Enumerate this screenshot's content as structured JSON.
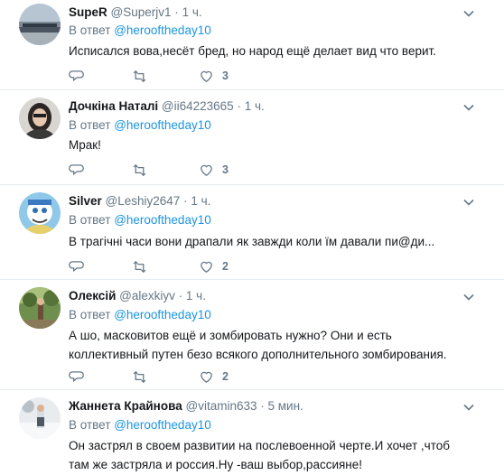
{
  "tweets": [
    {
      "name": "SupeR",
      "handle": "@Superjv1",
      "time": "1 ч.",
      "reply_prefix": "В ответ",
      "reply_to": "@herooftheday10",
      "text": "Исписался вова,несёт бред, но народ ещё делает вид что верит.",
      "likes": "3",
      "avatar_icon": "landscape-avatar"
    },
    {
      "name": "Дочкіна Наталі",
      "handle": "@ii64223665",
      "time": "1 ч.",
      "reply_prefix": "В ответ",
      "reply_to": "@herooftheday10",
      "text": "Мрак!",
      "likes": "3",
      "avatar_icon": "woman-photo-avatar"
    },
    {
      "name": "Silver",
      "handle": "@Leshiy2647",
      "time": "1 ч.",
      "reply_prefix": "В ответ",
      "reply_to": "@herooftheday10",
      "text": "В трагічні часи вони драпали як завжди коли їм давали пи@ди...",
      "likes": "2",
      "avatar_icon": "cartoon-avatar"
    },
    {
      "name": "Олексій",
      "handle": "@alexkiyv",
      "time": "1 ч.",
      "reply_prefix": "В ответ",
      "reply_to": "@herooftheday10",
      "text": "А шо, масковитов ещё и зомбировать нужно? Они и есть коллективный путен безо всякого дополнительного зомбирования.",
      "likes": "2",
      "avatar_icon": "person-outdoor-avatar"
    },
    {
      "name": "Жаннета Крайнова",
      "handle": "@vitamin633",
      "time": "5 мин.",
      "reply_prefix": "В ответ",
      "reply_to": "@herooftheday10",
      "text": "Он застрял в своем развитии на послевоенной черте.И хочет ,чтоб там же застряла и россия.Ну -ваш выбор,рассияне!",
      "likes": "",
      "avatar_icon": "woman-snow-avatar"
    }
  ],
  "colors": {
    "accent": "#1b95e0",
    "secondary_text": "#657786",
    "primary_text": "#14171a",
    "divider": "#e6ecf0"
  }
}
